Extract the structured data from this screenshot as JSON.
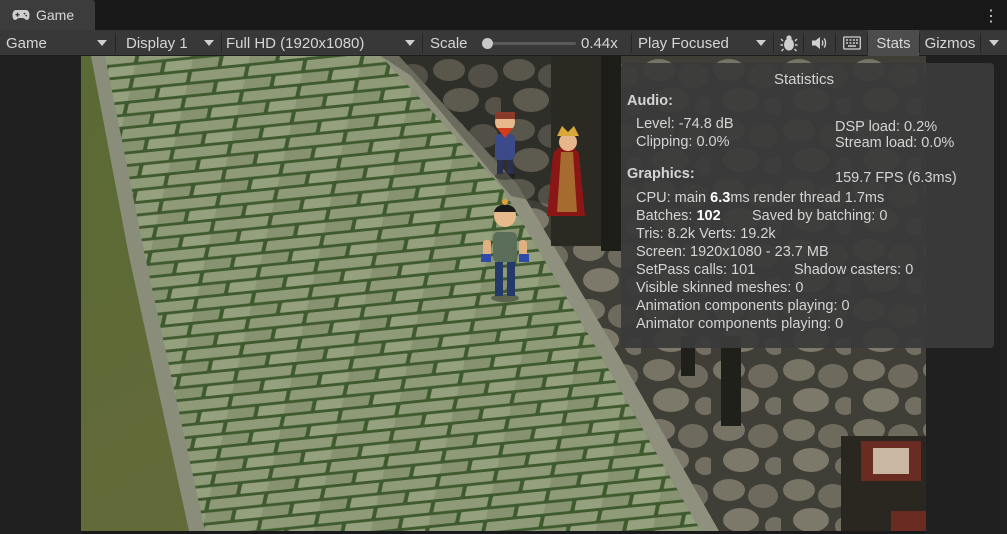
{
  "tab": {
    "title": "Game",
    "icon": "gamepad-icon"
  },
  "toolbar": {
    "view_select": "Game",
    "display_select": "Display 1",
    "resolution_select": "Full HD (1920x1080)",
    "scale_label": "Scale",
    "scale_value": "0.44x",
    "scale_fraction": 0.05,
    "play_mode_select": "Play Focused",
    "stats_label": "Stats",
    "gizmos_label": "Gizmos",
    "icons": [
      "bug-icon",
      "speaker-icon",
      "keyboard-icon",
      "more-vertical-icon"
    ]
  },
  "stats": {
    "title": "Statistics",
    "audio_header": "Audio:",
    "level": "Level: -74.8 dB",
    "clipping": "Clipping: 0.0%",
    "dsp_load": "DSP load: 0.2%",
    "stream_load": "Stream load: 0.0%",
    "graphics_header": "Graphics:",
    "fps": "159.7 FPS (6.3ms)",
    "cpu_prefix": "CPU: main ",
    "cpu_main": "6.3",
    "cpu_suffix": "ms  render thread 1.7ms",
    "batches_prefix": "Batches: ",
    "batches_value": "102",
    "saved_batching": "Saved by batching: 0",
    "tris_verts": "Tris: 8.2k  Verts: 19.2k",
    "screen": "Screen: 1920x1080 - 23.7 MB",
    "setpass": "SetPass calls: 101",
    "shadow_casters": "Shadow casters: 0",
    "skinned": "Visible skinned meshes: 0",
    "animation": "Animation components playing: 0",
    "animator": "Animator components playing: 0"
  }
}
